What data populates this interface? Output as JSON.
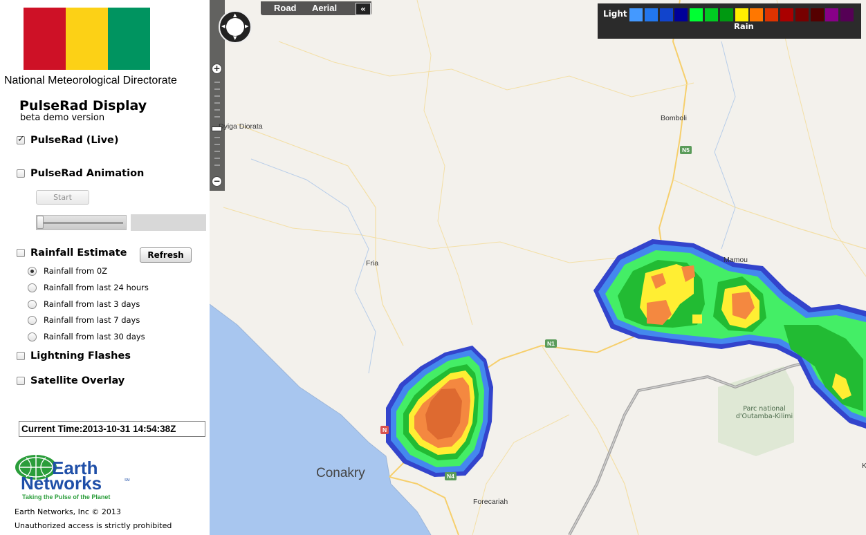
{
  "sidebar": {
    "flag_colors": [
      "#ce1126",
      "#fcd116",
      "#009460"
    ],
    "org_title": "National Meteorological Directorate",
    "app_title": "PulseRad Display",
    "app_subtitle": "beta demo version",
    "options": {
      "live": {
        "label": "PulseRad (Live)",
        "checked": true
      },
      "animation": {
        "label": "PulseRad Animation",
        "checked": false
      },
      "rainfall": {
        "label": "Rainfall Estimate",
        "checked": false
      },
      "lightning": {
        "label": "Lightning Flashes",
        "checked": false
      },
      "satellite": {
        "label": "Satellite Overlay",
        "checked": false
      }
    },
    "start_label": "Start",
    "refresh_label": "Refresh",
    "rainfall_ranges": [
      {
        "label": "Rainfall from 0Z",
        "selected": true
      },
      {
        "label": "Rainfall from last 24 hours",
        "selected": false
      },
      {
        "label": "Rainfall from last 3 days",
        "selected": false
      },
      {
        "label": "Rainfall from last 7 days",
        "selected": false
      },
      {
        "label": "Rainfall from last 30 days",
        "selected": false
      }
    ],
    "current_time": "Current Time:2013-10-31 14:54:38Z",
    "logo": {
      "line1": "Earth",
      "line2": "Networks",
      "mark": "SM",
      "tagline": "Taking the Pulse of the Planet"
    },
    "footer_copyright": "Earth Networks, Inc © 2013",
    "footer_notice": "Unauthorized access is strictly prohibited"
  },
  "map": {
    "view_road": "Road",
    "view_aerial": "Aerial",
    "collapse_icon": "«",
    "places": {
      "dyiga": "Dyiga Diorata",
      "bomboli": "Bomboli",
      "fria": "Fria",
      "mamou": "Mamou",
      "conakry": "Conakry",
      "forecariah": "Forecariah",
      "park": "Parc national d'Outamba-Kilimi",
      "edge_k": "K"
    },
    "shields": {
      "n5": "N5",
      "n1": "N1",
      "n4": "N4",
      "n": "N"
    },
    "legend": {
      "light_label": "Light",
      "rain_label": "Rain",
      "colors": [
        "#4499ff",
        "#2277ee",
        "#1144cc",
        "#000099",
        "#00ff33",
        "#00cc22",
        "#009911",
        "#ffee00",
        "#ff7700",
        "#dd3300",
        "#aa0000",
        "#770000",
        "#550000",
        "#880088",
        "#550055"
      ]
    },
    "radar_colors": {
      "outer": "#3344cc",
      "mid": "#4488ee",
      "green_light": "#44ee66",
      "green": "#22bb33",
      "yellow": "#ffee33",
      "orange": "#f48840",
      "red_core": "#d9652e"
    }
  }
}
